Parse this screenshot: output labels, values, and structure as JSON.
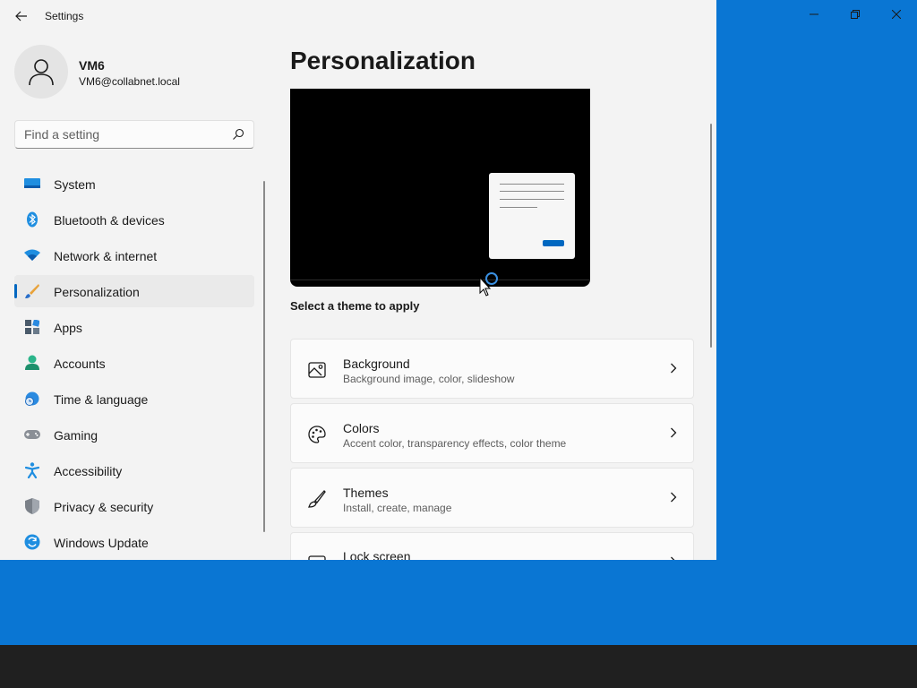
{
  "app": {
    "title": "Settings"
  },
  "user": {
    "name": "VM6",
    "email": "VM6@collabnet.local"
  },
  "search": {
    "placeholder": "Find a setting"
  },
  "sidebar": {
    "items": [
      {
        "label": "System",
        "icon": "system-icon"
      },
      {
        "label": "Bluetooth & devices",
        "icon": "bluetooth-icon"
      },
      {
        "label": "Network & internet",
        "icon": "wifi-icon"
      },
      {
        "label": "Personalization",
        "icon": "brush-icon",
        "active": true
      },
      {
        "label": "Apps",
        "icon": "apps-icon"
      },
      {
        "label": "Accounts",
        "icon": "accounts-icon"
      },
      {
        "label": "Time & language",
        "icon": "globe-clock-icon"
      },
      {
        "label": "Gaming",
        "icon": "gamepad-icon"
      },
      {
        "label": "Accessibility",
        "icon": "accessibility-icon"
      },
      {
        "label": "Privacy & security",
        "icon": "shield-icon"
      },
      {
        "label": "Windows Update",
        "icon": "update-icon"
      }
    ]
  },
  "main": {
    "title": "Personalization",
    "section_label": "Select a theme to apply",
    "cards": [
      {
        "title": "Background",
        "subtitle": "Background image, color, slideshow",
        "icon": "image-icon"
      },
      {
        "title": "Colors",
        "subtitle": "Accent color, transparency effects, color theme",
        "icon": "palette-icon"
      },
      {
        "title": "Themes",
        "subtitle": "Install, create, manage",
        "icon": "brush-icon"
      },
      {
        "title": "Lock screen",
        "subtitle": "",
        "icon": "lock-screen-icon"
      }
    ]
  },
  "colors": {
    "accent": "#0067c0",
    "desktop": "#0a76d3",
    "taskbar": "#202020",
    "window_bg": "#f3f3f3"
  }
}
